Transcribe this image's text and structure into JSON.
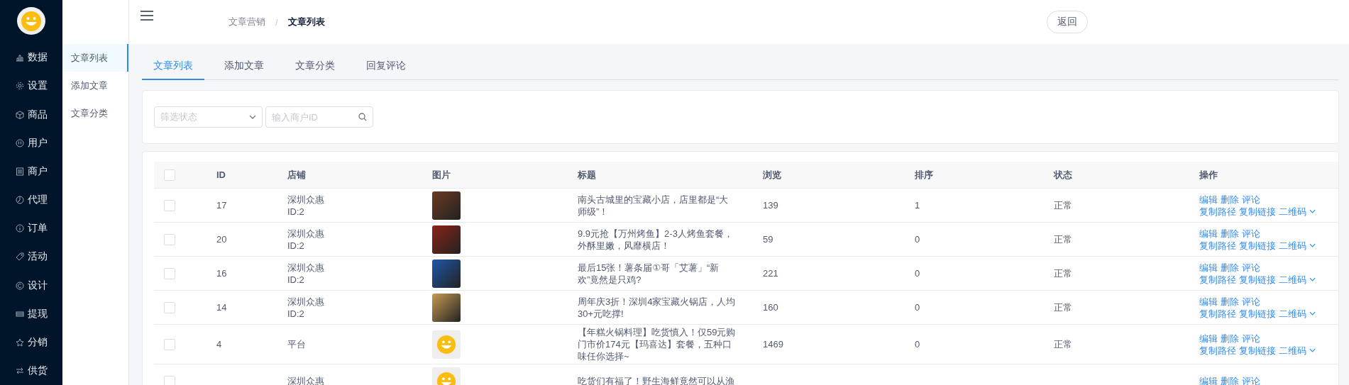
{
  "sidebar": {
    "items": [
      {
        "label": "数据"
      },
      {
        "label": "设置"
      },
      {
        "label": "商品"
      },
      {
        "label": "用户"
      },
      {
        "label": "商户"
      },
      {
        "label": "代理"
      },
      {
        "label": "订单"
      },
      {
        "label": "活动"
      },
      {
        "label": "设计"
      },
      {
        "label": "提现"
      },
      {
        "label": "分销"
      },
      {
        "label": "供货"
      }
    ]
  },
  "submenu": {
    "items": [
      {
        "label": "文章列表",
        "selected": true
      },
      {
        "label": "添加文章",
        "selected": false
      },
      {
        "label": "文章分类",
        "selected": false
      }
    ]
  },
  "header": {
    "breadcrumb": [
      "文章营销",
      "文章列表"
    ],
    "breadcrumb_separator": "/",
    "back_button": "返回"
  },
  "tabs": [
    {
      "label": "文章列表",
      "selected": true
    },
    {
      "label": "添加文章",
      "selected": false
    },
    {
      "label": "文章分类",
      "selected": false
    },
    {
      "label": "回复评论",
      "selected": false
    }
  ],
  "filters": {
    "status_select": {
      "placeholder": "筛选状态"
    },
    "merchant_search": {
      "placeholder": "输入商户ID"
    }
  },
  "table": {
    "select_all_checked": false,
    "columns": [
      "ID",
      "店铺",
      "图片",
      "标题",
      "浏览",
      "排序",
      "状态",
      "操作"
    ],
    "rows": [
      {
        "checked": false,
        "id": "17",
        "store": "深圳众惠",
        "store_id": "ID:2",
        "kind": "photo",
        "title": "南头古城里的宝藏小店，店里都是“大师级”！",
        "views": "139",
        "sort": "1",
        "status": "正常",
        "actions": [
          "编辑",
          "删除",
          "评论"
        ],
        "more_actions": [
          "复制路径",
          "复制链接",
          "二维码"
        ]
      },
      {
        "checked": false,
        "id": "20",
        "store": "深圳众惠",
        "store_id": "ID:2",
        "kind": "photo",
        "title": "9.9元抢【万州烤鱼】2-3人烤鱼套餐，外酥里嫩，风靡横店！",
        "views": "59",
        "sort": "0",
        "status": "正常",
        "actions": [
          "编辑",
          "删除",
          "评论"
        ],
        "more_actions": [
          "复制路径",
          "复制链接",
          "二维码"
        ]
      },
      {
        "checked": false,
        "id": "16",
        "store": "深圳众惠",
        "store_id": "ID:2",
        "kind": "photo",
        "title": "最后15张！薯条届①哥「艾薯」“新欢”竟然是只鸡?",
        "views": "221",
        "sort": "0",
        "status": "正常",
        "actions": [
          "编辑",
          "删除",
          "评论"
        ],
        "more_actions": [
          "复制路径",
          "复制链接",
          "二维码"
        ]
      },
      {
        "checked": false,
        "id": "14",
        "store": "深圳众惠",
        "store_id": "ID:2",
        "kind": "photo",
        "title": "周年庆3折！深圳4家宝藏火锅店，人均30+元吃撑!",
        "views": "160",
        "sort": "0",
        "status": "正常",
        "actions": [
          "编辑",
          "删除",
          "评论"
        ],
        "more_actions": [
          "复制路径",
          "复制链接",
          "二维码"
        ]
      },
      {
        "checked": false,
        "id": "4",
        "store": "平台",
        "kind": "placeholder",
        "title": "【年糕火锅料理】吃货慎入！仅59元购门市价174元【玛喜达】套餐，五种口味任你选择~",
        "views": "1469",
        "sort": "0",
        "status": "正常",
        "actions": [
          "编辑",
          "删除",
          "评论"
        ],
        "more_actions": [
          "复制路径",
          "复制链接",
          "二维码"
        ]
      },
      {
        "checked": false,
        "store": "深圳众惠",
        "kind": "placeholder",
        "title": "吃货们有福了！野生海鲜竟然可以从渔",
        "actions": [
          "编辑",
          "删除",
          "评论"
        ]
      }
    ]
  }
}
